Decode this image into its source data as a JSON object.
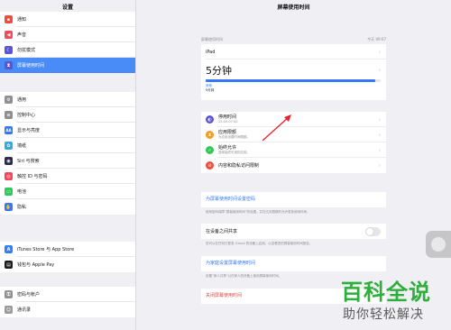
{
  "sidebar": {
    "title": "设置",
    "group1": [
      {
        "label": "通知",
        "icon": "notifications-icon",
        "color": "#f14a3e"
      },
      {
        "label": "声音",
        "icon": "sound-icon",
        "color": "#f14a58"
      },
      {
        "label": "勿扰模式",
        "icon": "moon-icon",
        "color": "#5b55d6"
      },
      {
        "label": "屏幕使用时间",
        "icon": "hourglass-icon",
        "color": "#5b55d6",
        "selected": true
      }
    ],
    "group2": [
      {
        "label": "通用",
        "icon": "gear-icon",
        "color": "#8e8e93"
      },
      {
        "label": "控制中心",
        "icon": "control-center-icon",
        "color": "#8e8e93"
      },
      {
        "label": "显示与亮度",
        "icon": "display-icon",
        "color": "#3478f6",
        "glyph": "AA"
      },
      {
        "label": "墙纸",
        "icon": "wallpaper-icon",
        "color": "#34aadc"
      },
      {
        "label": "Siri 与搜索",
        "icon": "siri-icon",
        "color": "#2b2b52"
      },
      {
        "label": "触控 ID 与密码",
        "icon": "fingerprint-icon",
        "color": "#f1465a"
      },
      {
        "label": "电池",
        "icon": "battery-icon",
        "color": "#34c759"
      },
      {
        "label": "隐私",
        "icon": "privacy-hand-icon",
        "color": "#3478f6"
      }
    ],
    "group3": [
      {
        "label": "iTunes Store 与 App Store",
        "icon": "app-store-icon",
        "color": "#2f80f6"
      },
      {
        "label": "钱包与 Apple Pay",
        "icon": "wallet-icon",
        "color": "#1c1c1e"
      }
    ],
    "group4": [
      {
        "label": "密码与帐户",
        "icon": "key-icon",
        "color": "#8e8e93"
      },
      {
        "label": "通讯录",
        "icon": "contacts-icon",
        "color": "#9a9a9e"
      }
    ]
  },
  "main": {
    "title": "屏幕使用时间",
    "caption_left": "屏幕使用时间",
    "caption_right": "今天 09:07",
    "device": "iPad",
    "total": "5分钟",
    "bar_fraction": 0.97,
    "bar_label": "其他",
    "bar_value": "5分钟",
    "rows": [
      {
        "label": "停用时间",
        "sub": "22:00-07:00",
        "icon": "downtime-icon",
        "color": "#5b55d6"
      },
      {
        "label": "应用限额",
        "sub": "为应用设置时间限额。",
        "icon": "app-limits-icon",
        "color": "#f59b1f"
      },
      {
        "label": "始终允许",
        "sub": "选择始终可用的应用。",
        "icon": "always-allowed-icon",
        "color": "#34c759"
      },
      {
        "label": "内容和隐私访问限制",
        "sub": "",
        "icon": "restrictions-icon",
        "color": "#f14a3e"
      }
    ],
    "passcode_link": "为屏幕使用时间设置密码",
    "passcode_note": "使用密码保障“屏幕使用时间”的设置，并在达到限额时允许更多使用时间。",
    "share_label": "在设备之间共享",
    "share_note": "您可以在任何已登录 iCloud 的设备上启用，以查看您的屏幕使用时间报告。",
    "family_link": "为家庭设置屏幕使用时间",
    "family_note": "设置“家人共享”以在家人的设备上使用屏幕使用时间。",
    "turn_off": "关闭屏幕使用时间"
  },
  "watermark": {
    "main": "百科全说",
    "sub": "助你轻松解决"
  }
}
